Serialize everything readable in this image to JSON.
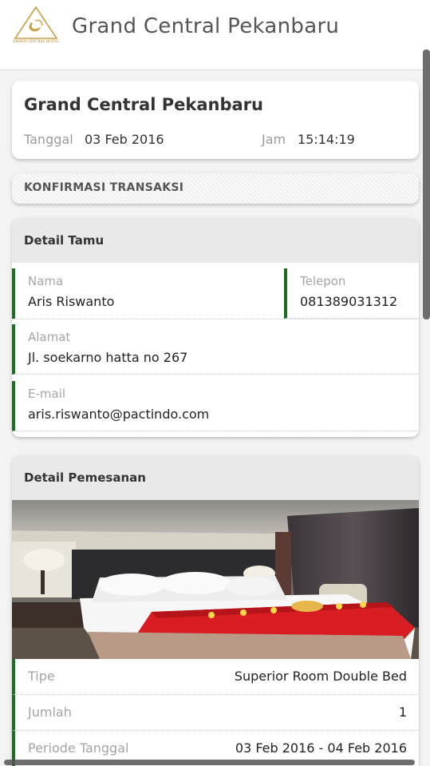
{
  "app": {
    "title": "Grand Central Pekanbaru",
    "logo_text": "GRAND CENTRAL HOTEL"
  },
  "hotel_card": {
    "name": "Grand Central Pekanbaru",
    "date_label": "Tanggal",
    "date_value": "03 Feb 2016",
    "time_label": "Jam",
    "time_value": "15:14:19"
  },
  "confirmation": {
    "label": "KONFIRMASI TRANSAKSI"
  },
  "guest": {
    "title": "Detail Tamu",
    "name_label": "Nama",
    "name_value": "Aris Riswanto",
    "phone_label": "Telepon",
    "phone_value": "081389031312",
    "address_label": "Alamat",
    "address_value": "Jl. soekarno hatta no 267",
    "email_label": "E-mail",
    "email_value": "aris.riswanto@pactindo.com"
  },
  "order": {
    "title": "Detail Pemesanan",
    "rows": [
      {
        "label": "Tipe",
        "value": "Superior Room Double Bed"
      },
      {
        "label": "Jumlah",
        "value": "1"
      },
      {
        "label": "Periode Tanggal",
        "value": "03 Feb 2016 - 04 Feb 2016"
      }
    ]
  },
  "colors": {
    "accent_bar": "#1e6b23",
    "logo_gold": "#c8a24a"
  }
}
